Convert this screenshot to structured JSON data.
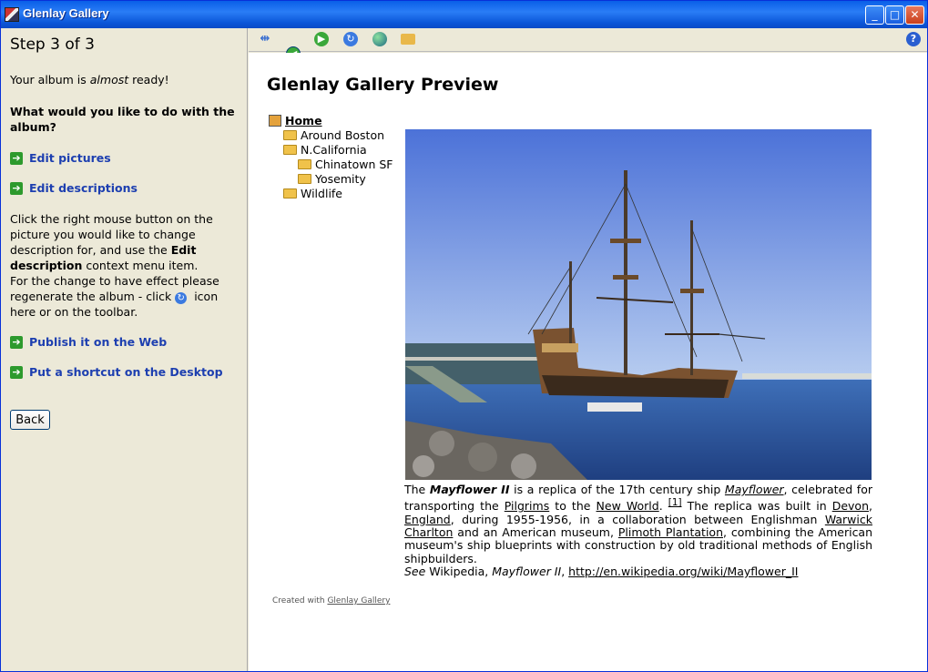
{
  "window": {
    "title": "Glenlay Gallery",
    "min": "_",
    "max": "□",
    "close": "✕"
  },
  "left": {
    "step": "Step 3 of 3",
    "ready_pre": "Your album is ",
    "ready_em": "almost",
    "ready_post": " ready!",
    "question": "What would you like to do with the album?",
    "actions": [
      {
        "label": "Edit pictures",
        "icon": "green-arrow-icon"
      },
      {
        "label": "Edit descriptions",
        "icon": "green-arrow-icon"
      },
      {
        "label": "Publish it on the Web",
        "icon": "green-arrow-icon"
      },
      {
        "label": "Put a shortcut on the Desktop",
        "icon": "green-arrow-icon"
      }
    ],
    "help_1": "Click the right mouse button on the picture you would like to change description for, and use the ",
    "help_bold": "Edit description",
    "help_2": " context menu item.",
    "help_3": "For the change to have effect please regenerate the album - click",
    "help_4": "icon here or on the toolbar.",
    "back": "Back"
  },
  "toolbar": {
    "icons": [
      "split-view-icon",
      "back-icon",
      "forward-icon",
      "refresh-icon",
      "globe-icon",
      "open-folder-icon",
      "help-icon"
    ],
    "help": "?"
  },
  "preview": {
    "title": "Glenlay Gallery Preview",
    "tree": {
      "home": "Home",
      "items": [
        "Around Boston",
        "N.California",
        "Chinatown SF",
        "Yosemity",
        "Wildlife"
      ]
    },
    "caption": {
      "p1": "The ",
      "b1": "Mayflower II",
      "p2": " is a replica of the 17th century ship ",
      "l1": "Mayflower",
      "p3": ", celebrated for transporting the ",
      "l2": "Pilgrims",
      "p4": " to the ",
      "l3": "New World",
      "p5": ". ",
      "ref": "[1]",
      "p6": " The replica was built in ",
      "l4": "Devon",
      "p7": ", ",
      "l5": "England",
      "p8": ", during 1955-1956, in a collaboration between Englishman ",
      "l6": "Warwick Charlton",
      "p9": " and an American museum, ",
      "l7": "Plimoth Plantation",
      "p10": ", combining the American museum's ship blueprints with construction by old traditional methods of English shipbuilders.",
      "see": "See",
      "p11": " Wikipedia, ",
      "i2": "Mayflower II",
      "p12": ", ",
      "url": "http://en.wikipedia.org/wiki/Mayflower_II"
    },
    "credit_pre": "Created with ",
    "credit_link": "Glenlay Gallery"
  }
}
